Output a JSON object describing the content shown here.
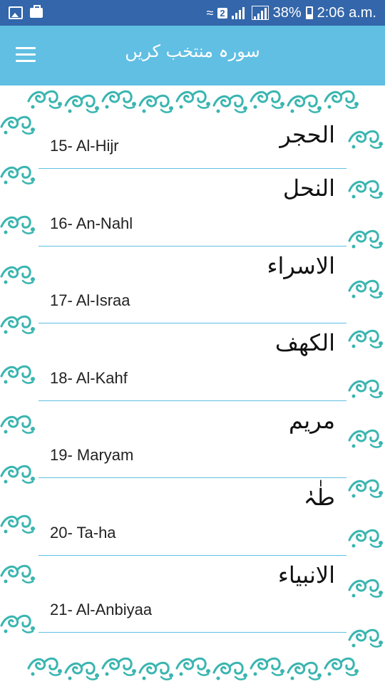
{
  "status_bar": {
    "battery": "38%",
    "time": "2:06 a.m.",
    "sim_badge": "2"
  },
  "appbar": {
    "title": "سورہ منتخب کریں"
  },
  "surahs": [
    {
      "arabic": "الحجر",
      "label": "15- Al-Hijr"
    },
    {
      "arabic": "النحل",
      "label": "16- An-Nahl"
    },
    {
      "arabic": "الاسراء",
      "label": "17- Al-Israa"
    },
    {
      "arabic": "الکھف",
      "label": "18- Al-Kahf"
    },
    {
      "arabic": "مریم",
      "label": "19- Maryam"
    },
    {
      "arabic": "طٰہٰ",
      "label": "20- Ta-ha"
    },
    {
      "arabic": "الانبیاء",
      "label": "21- Al-Anbiyaa"
    }
  ],
  "colors": {
    "status_bar": "#3366aa",
    "appbar": "#60bfe3",
    "divider": "#60bfe3",
    "border_ornament": "#3ab5b0"
  }
}
